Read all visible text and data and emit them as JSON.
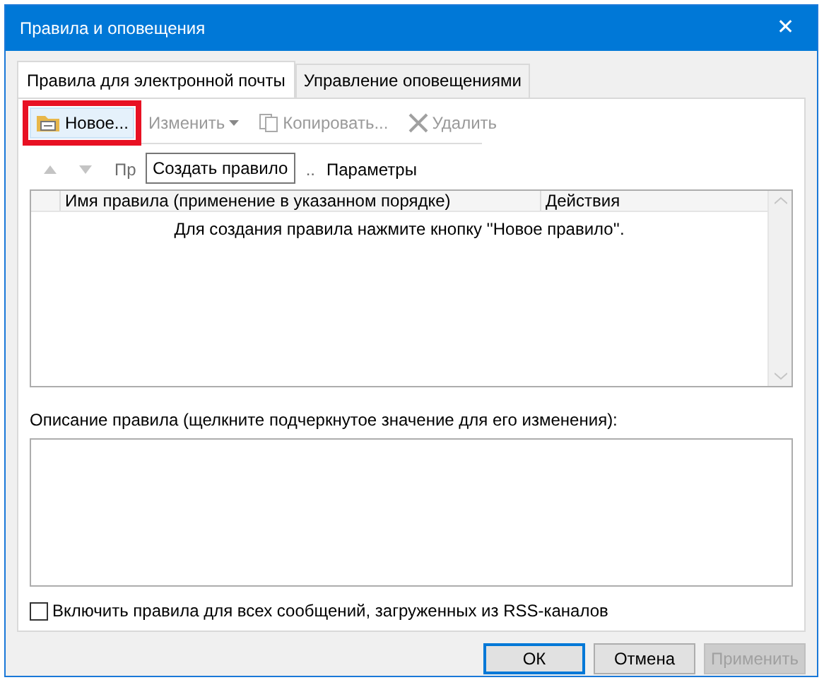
{
  "window": {
    "title": "Правила и оповещения",
    "close": "✕"
  },
  "tabs": [
    {
      "label": "Правила для электронной почты",
      "selected": true
    },
    {
      "label": "Управление оповещениями",
      "selected": false
    }
  ],
  "toolbar": [
    {
      "kind": "new",
      "label": "Новое...",
      "disabled": false,
      "highlighted": true
    },
    {
      "kind": "edit",
      "label": "Изменить",
      "disabled": true,
      "highlighted": false
    },
    {
      "kind": "copy",
      "label": "Копировать...",
      "disabled": true,
      "highlighted": false
    },
    {
      "kind": "delete",
      "label": "Удалить",
      "disabled": true,
      "highlighted": false
    }
  ],
  "order_bar": {
    "run_prefix": "Пр",
    "run_suffix": "..",
    "options": "Параметры"
  },
  "tooltip": "Создать правило",
  "table": {
    "columns": [
      "Имя правила (применение в указанном порядке)",
      "Действия"
    ],
    "empty_message": "Для создания правила нажмите кнопку ''Новое правило''."
  },
  "description": {
    "label": "Описание правила (щелкните подчеркнутое значение для его изменения):"
  },
  "rss_checkbox": {
    "label": "Включить правила для всех сообщений, загруженных из RSS-каналов",
    "checked": false
  },
  "buttons": [
    {
      "label": "ОК",
      "default": true,
      "disabled": false
    },
    {
      "label": "Отмена",
      "default": false,
      "disabled": false
    },
    {
      "label": "Применить",
      "default": false,
      "disabled": true
    }
  ]
}
